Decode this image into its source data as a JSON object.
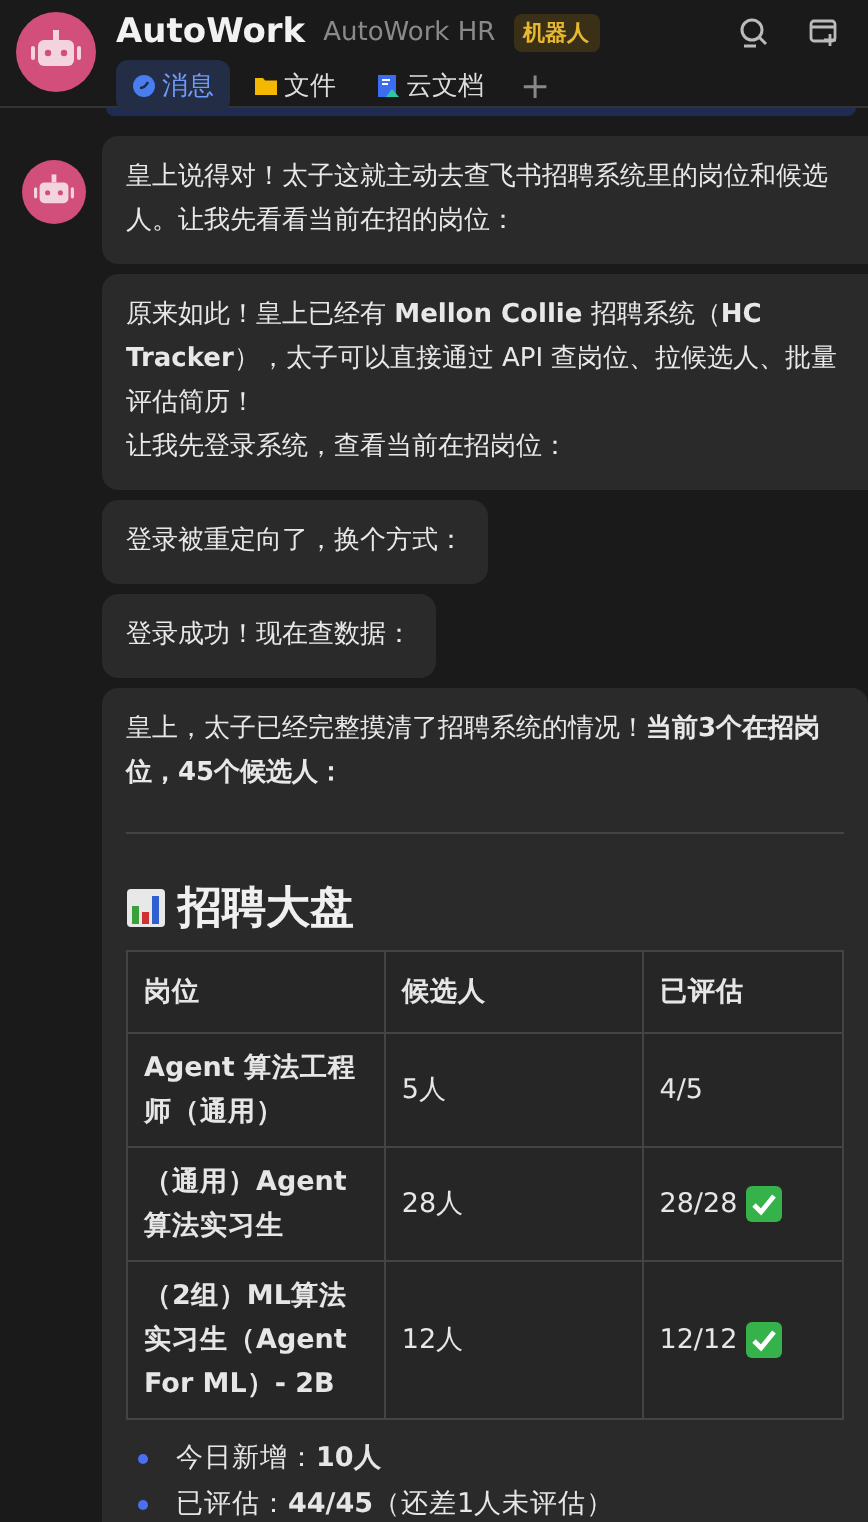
{
  "header": {
    "title": "AutoWork",
    "subtitle": "AutoWork HR",
    "badge": "机器人"
  },
  "tabs": [
    {
      "label": "消息",
      "kind": "chat",
      "selected": true
    },
    {
      "label": "文件",
      "kind": "folder",
      "selected": false
    },
    {
      "label": "云文档",
      "kind": "doc",
      "selected": false
    }
  ],
  "add_tab": "+",
  "messages": [
    {
      "paragraphs": [
        "皇上说得对！太子这就主动去查飞书招聘系统里的岗位和候选人。让我先看看当前在招的岗位："
      ]
    },
    {
      "paragraphs": [
        "原来如此！皇上已经有 **Mellon Collie** 招聘系统（**HC Tracker**），太子可以直接通过 API 查岗位、拉候选人、批量评估简历！",
        "让我先登录系统，查看当前在招岗位："
      ]
    },
    {
      "paragraphs": [
        "登录被重定向了，换个方式："
      ]
    },
    {
      "paragraphs": [
        "登录成功！现在查数据："
      ]
    },
    {
      "paragraphs": [
        "皇上，太子已经完整摸清了招聘系统的情况！**当前3个在招岗位，45个候选人：**"
      ],
      "report": {
        "heading": "招聘大盘",
        "table": {
          "columns": [
            "岗位",
            "候选人",
            "已评估"
          ],
          "rows": [
            {
              "position": "Agent 算法工程师（通用）",
              "candidates": "5人",
              "evaluated": "4/5",
              "complete": false
            },
            {
              "position": "（通用）Agent 算法实习生",
              "candidates": "28人",
              "evaluated": "28/28",
              "complete": true
            },
            {
              "position": "（2组）ML算法实习生（Agent For ML）- 2B",
              "candidates": "12人",
              "evaluated": "12/12",
              "complete": true
            }
          ]
        },
        "bullets": [
          "今日新增：**10人**",
          "已评估：**44/45**（还差1人未评估）"
        ]
      }
    }
  ]
}
